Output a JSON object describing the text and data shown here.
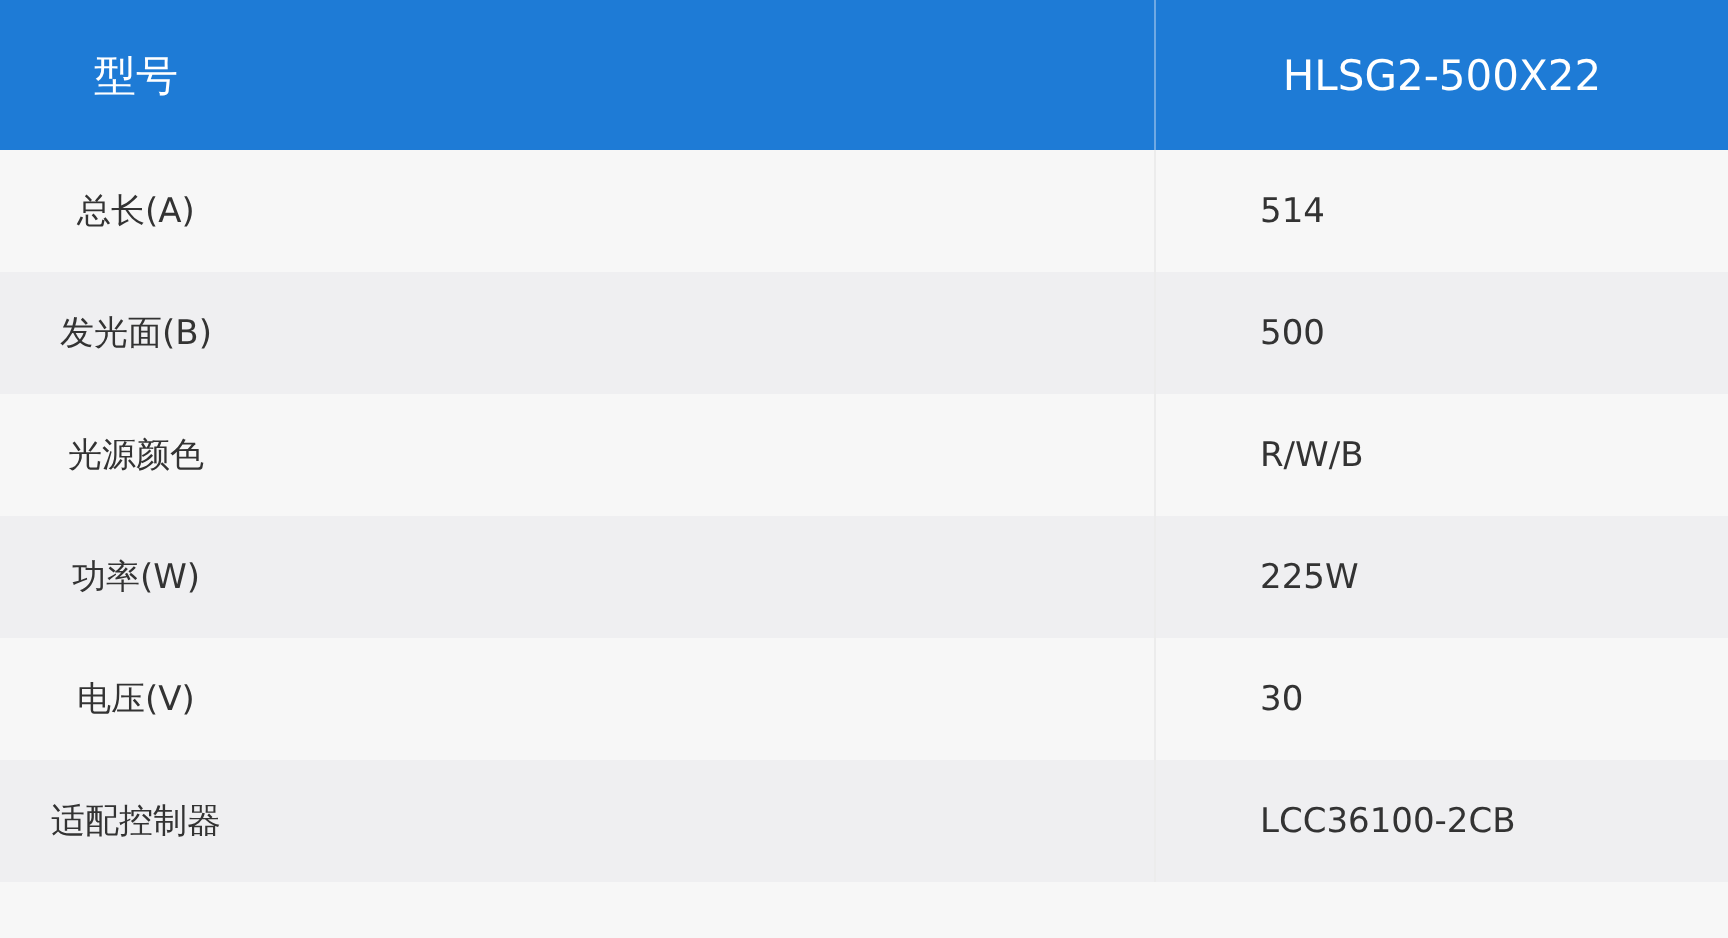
{
  "table": {
    "columns": [
      "型号",
      "HLSG2-500X22"
    ],
    "rows": [
      {
        "label": "总长(A)",
        "value": "514"
      },
      {
        "label": "发光面(B)",
        "value": "500"
      },
      {
        "label": "光源颜色",
        "value": "R/W/B"
      },
      {
        "label": "功率(W)",
        "value": "225W"
      },
      {
        "label": "电压(V)",
        "value": "30"
      },
      {
        "label": "适配控制器",
        "value": "LCC36100-2CB"
      }
    ]
  }
}
